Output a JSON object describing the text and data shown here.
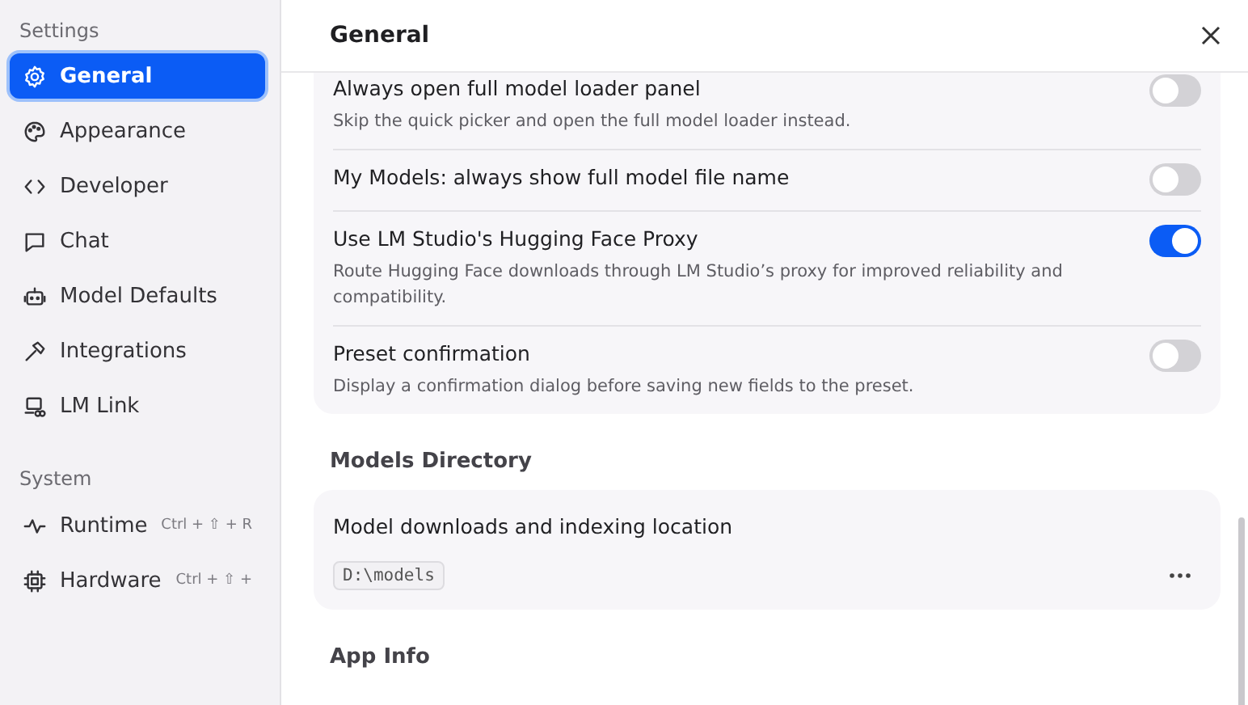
{
  "sidebar": {
    "sections": [
      {
        "heading": "Settings",
        "items": [
          {
            "label": "General",
            "selected": true
          },
          {
            "label": "Appearance",
            "selected": false
          },
          {
            "label": "Developer",
            "selected": false
          },
          {
            "label": "Chat",
            "selected": false
          },
          {
            "label": "Model Defaults",
            "selected": false
          },
          {
            "label": "Integrations",
            "selected": false
          },
          {
            "label": "LM Link",
            "selected": false
          }
        ]
      },
      {
        "heading": "System",
        "items": [
          {
            "label": "Runtime",
            "shortcut": "Ctrl + ⇧ + R",
            "selected": false
          },
          {
            "label": "Hardware",
            "shortcut": "Ctrl + ⇧ +",
            "selected": false
          }
        ]
      }
    ]
  },
  "header": {
    "title": "General"
  },
  "toggles": [
    {
      "title": "Always open full model loader panel",
      "description": "Skip the quick picker and open the full model loader instead.",
      "on": false
    },
    {
      "title": "My Models: always show full model file name",
      "on": false
    },
    {
      "title": "Use LM Studio's Hugging Face Proxy",
      "description": "Route Hugging Face downloads through LM Studio’s proxy for improved reliability and compatibility.",
      "on": true
    },
    {
      "title": "Preset confirmation",
      "description": "Display a confirmation dialog before saving new fields to the preset.",
      "on": false
    }
  ],
  "models_directory": {
    "heading": "Models Directory",
    "label": "Model downloads and indexing location",
    "path": "D:\\models"
  },
  "app_info": {
    "heading": "App Info"
  }
}
